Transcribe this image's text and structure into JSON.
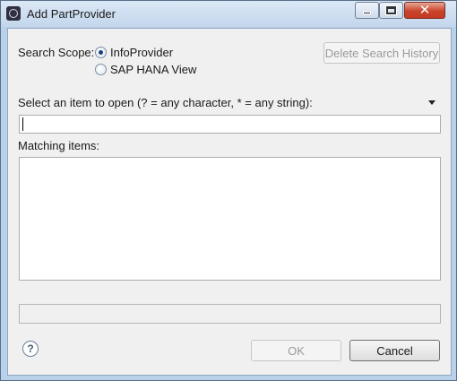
{
  "window": {
    "title": "Add PartProvider"
  },
  "scope": {
    "label": "Search Scope:",
    "options": [
      {
        "label": "InfoProvider",
        "selected": true
      },
      {
        "label": "SAP HANA View",
        "selected": false
      }
    ]
  },
  "delete_history_label": "Delete Search History",
  "select_label": "Select an item to open (? = any character, * = any string):",
  "search": {
    "value": "",
    "placeholder": ""
  },
  "matching_label": "Matching items:",
  "matching_items": [],
  "footer": {
    "ok_label": "OK",
    "cancel_label": "Cancel",
    "help_glyph": "?"
  },
  "icons": [
    "app-icon",
    "minimize-icon",
    "maximize-icon",
    "close-icon",
    "dropdown-arrow-icon",
    "help-icon"
  ]
}
